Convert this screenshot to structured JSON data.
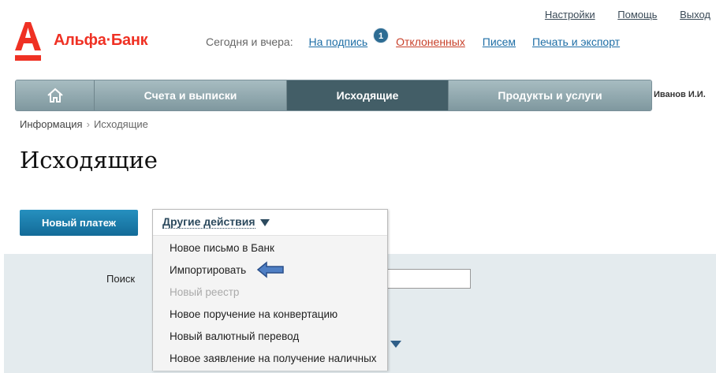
{
  "header": {
    "links": [
      "Настройки",
      "Помощь",
      "Выход"
    ],
    "logo_text": "Альфа·Банк",
    "brand_color": "#ef3124",
    "quick_label": "Сегодня и вчера:",
    "quick_links": [
      "На подпись",
      "Отклоненных",
      "Писем",
      "Печать и экспорт"
    ],
    "badge_count": "1"
  },
  "nav": {
    "items": [
      {
        "label": ""
      },
      {
        "label": "Счета и выписки"
      },
      {
        "label": "Исходящие"
      },
      {
        "label": "Продукты и услуги"
      }
    ],
    "active_index": 2,
    "user": "Иванов И.И."
  },
  "breadcrumb": {
    "items": [
      "Информация",
      "Исходящие"
    ],
    "separator": "›"
  },
  "page_title": "Исходящие",
  "actions": {
    "new_payment": "Новый платеж",
    "other_actions": "Другие действия",
    "menu": [
      {
        "label": "Новое письмо в Банк",
        "enabled": true
      },
      {
        "label": "Импортировать",
        "enabled": true
      },
      {
        "label": "Новый реестр",
        "enabled": false
      },
      {
        "label": "Новое поручение на конвертацию",
        "enabled": true
      },
      {
        "label": "Новый валютный перевод",
        "enabled": true
      },
      {
        "label": "Новое заявление на получение наличных",
        "enabled": true
      }
    ]
  },
  "filter": {
    "search_label": "Поиск",
    "search_value": ""
  }
}
